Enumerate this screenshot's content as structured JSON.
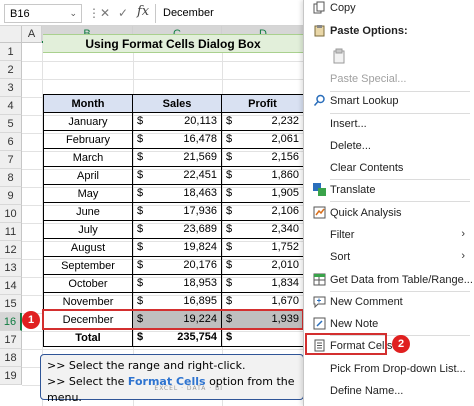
{
  "formula_bar": {
    "name_box": "B16",
    "name_box_arrow": "⌄",
    "options_glyph": "⋮",
    "cancel_glyph": "✕",
    "enter_glyph": "✓",
    "fx_label": "fx",
    "value": "December"
  },
  "columns": [
    "A",
    "B",
    "C",
    "D"
  ],
  "rows": [
    "1",
    "2",
    "3",
    "4",
    "5",
    "6",
    "7",
    "8",
    "9",
    "10",
    "11",
    "12",
    "13",
    "14",
    "15",
    "16",
    "17",
    "18",
    "19"
  ],
  "sheet": {
    "title": "Using Format Cells Dialog Box",
    "headers": {
      "month": "Month",
      "sales": "Sales",
      "profit": "Profit"
    },
    "currency": "$",
    "data_rows": [
      {
        "month": "January",
        "sales": "20,113",
        "profit": "2,232"
      },
      {
        "month": "February",
        "sales": "16,478",
        "profit": "2,061"
      },
      {
        "month": "March",
        "sales": "21,569",
        "profit": "2,156"
      },
      {
        "month": "April",
        "sales": "22,451",
        "profit": "1,860"
      },
      {
        "month": "May",
        "sales": "18,463",
        "profit": "1,905"
      },
      {
        "month": "June",
        "sales": "17,936",
        "profit": "2,106"
      },
      {
        "month": "July",
        "sales": "23,689",
        "profit": "2,340"
      },
      {
        "month": "August",
        "sales": "19,824",
        "profit": "1,752"
      },
      {
        "month": "September",
        "sales": "20,176",
        "profit": "2,010"
      },
      {
        "month": "October",
        "sales": "18,953",
        "profit": "1,834"
      },
      {
        "month": "November",
        "sales": "16,895",
        "profit": "1,670"
      },
      {
        "month": "December",
        "sales": "19,224",
        "profit": "1,939"
      }
    ],
    "total_label": "Total",
    "total_sales": "235,754",
    "total_profit": ""
  },
  "badges": {
    "step1": "1",
    "step2": "2"
  },
  "instructions": {
    "line1": ">> Select the range and right-click.",
    "line2_prefix": ">> Select the ",
    "line2_highlight": "Format Cells",
    "line2_suffix": " option from the menu.",
    "watermark": "EXCEL · DATA · BI"
  },
  "context_menu": {
    "items": [
      {
        "label": "Copy",
        "icon": "copy-icon"
      },
      {
        "label": "Paste Options:",
        "icon": "paste-icon"
      },
      {
        "label": "",
        "icon": "paste-clipboard-icon"
      },
      {
        "label": "Paste Special...",
        "icon": ""
      },
      {
        "label": "Smart Lookup",
        "icon": "search-icon"
      },
      {
        "label": "Insert...",
        "icon": ""
      },
      {
        "label": "Delete...",
        "icon": ""
      },
      {
        "label": "Clear Contents",
        "icon": ""
      },
      {
        "label": "Translate",
        "icon": "translate-icon"
      },
      {
        "label": "Quick Analysis",
        "icon": "quick-analysis-icon"
      },
      {
        "label": "Filter",
        "icon": ""
      },
      {
        "label": "Sort",
        "icon": ""
      },
      {
        "label": "Get Data from Table/Range...",
        "icon": "table-icon"
      },
      {
        "label": "New Comment",
        "icon": "comment-icon"
      },
      {
        "label": "New Note",
        "icon": "note-icon"
      },
      {
        "label": "Format Cells...",
        "icon": "format-cells-icon"
      },
      {
        "label": "Pick From Drop-down List...",
        "icon": ""
      },
      {
        "label": "Define Name...",
        "icon": ""
      }
    ]
  }
}
